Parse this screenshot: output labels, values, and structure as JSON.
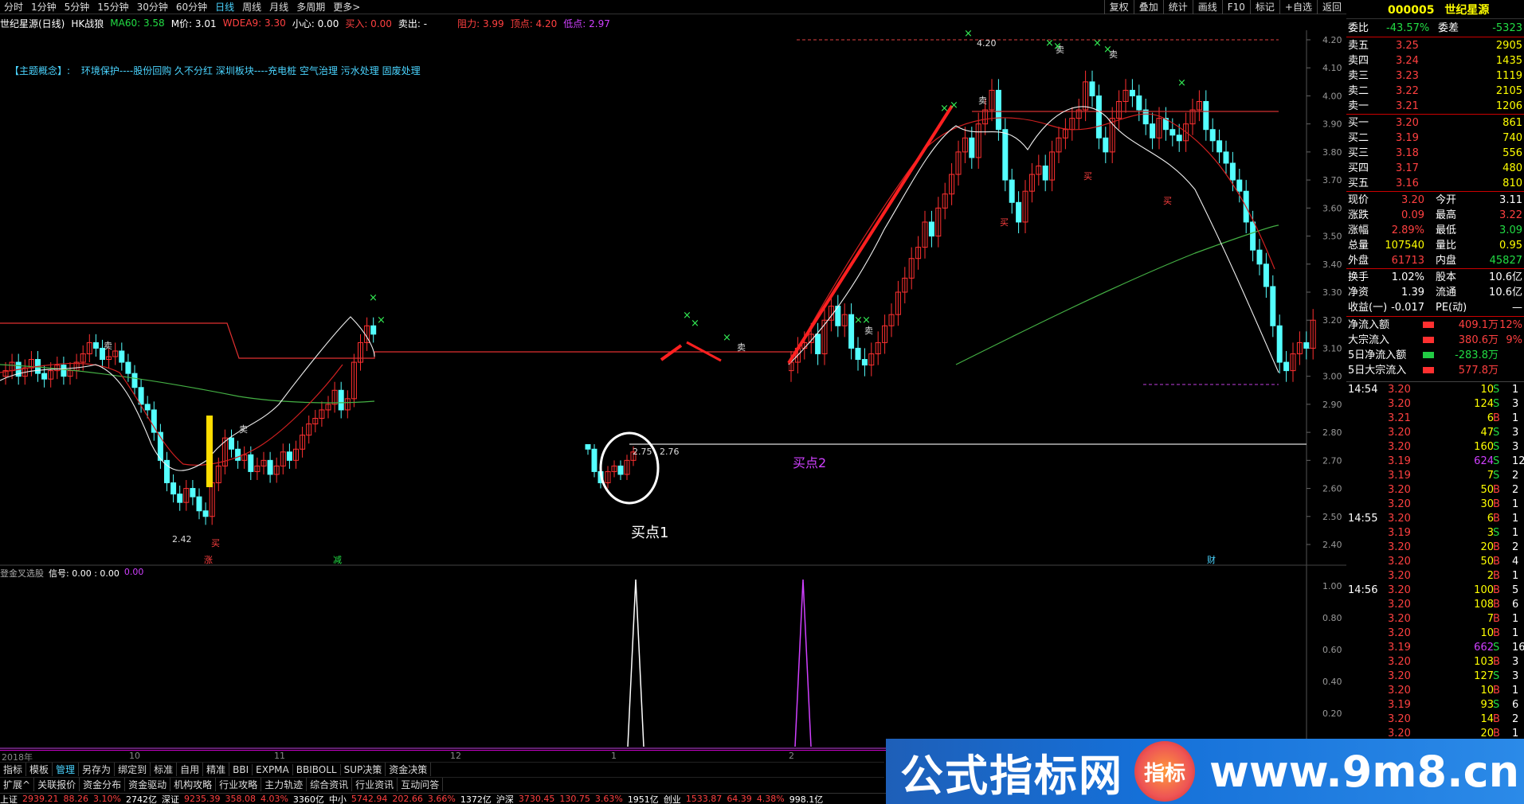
{
  "toolbar": {
    "periods": [
      "分时",
      "1分钟",
      "5分钟",
      "15分钟",
      "30分钟",
      "60分钟",
      "日线",
      "周线",
      "月线",
      "多周期",
      "更多>"
    ],
    "active": "日线",
    "right_tools": [
      "复权",
      "叠加",
      "统计",
      "画线",
      "F10",
      "标记",
      "+自选",
      "返回"
    ]
  },
  "info": {
    "name": "世纪星源(日线)",
    "plugin": "HK战狼",
    "ma60": "MA60: 3.58",
    "mprice": "M价: 3.01",
    "wdea": "WDEA9: 3.30",
    "center": "小心: 0.00",
    "buy": "买入: 0.00",
    "sell": "卖出: -",
    "resist": "阻力: 3.99",
    "top": "顶点: 4.20",
    "bottom": "低点: 2.97"
  },
  "concept": {
    "label": "【主题概念】:",
    "text": "环境保护----股份回购 久不分红 深圳板块----充电桩 空气治理 污水处理 固废处理"
  },
  "chart_labels": {
    "buy1": "买点1",
    "buy2": "买点2",
    "price_low": "2.42",
    "price_high": "4.20",
    "mid_a": "2.75",
    "mid_b": "2.76",
    "mark_zhang": "涨",
    "mark_jian": "减",
    "mark_cai": "财",
    "buy": "买",
    "sell": "卖"
  },
  "yaxis": [
    "4.20",
    "4.10",
    "4.00",
    "3.90",
    "3.80",
    "3.70",
    "3.60",
    "3.50",
    "3.40",
    "3.30",
    "3.20",
    "3.10",
    "3.00",
    "2.90",
    "2.80",
    "2.70",
    "2.60",
    "2.50",
    "2.40"
  ],
  "sub": {
    "name": "登金叉选股",
    "signal": "信号: 0.00 : 0.00",
    "val": "0.00",
    "yaxis": [
      "1.00",
      "0.80",
      "0.60",
      "0.40",
      "0.20"
    ]
  },
  "xaxis": {
    "labels": [
      "2018年",
      "10",
      "11",
      "12",
      "1",
      "2"
    ]
  },
  "ticker": {
    "code": "000005",
    "name": "世纪星源"
  },
  "quote": {
    "weibi": {
      "label": "委比",
      "value": "-43.57%",
      "label2": "委差",
      "value2": "-5323"
    },
    "sells": [
      {
        "label": "卖五",
        "price": "3.25",
        "vol": "2905"
      },
      {
        "label": "卖四",
        "price": "3.24",
        "vol": "1435"
      },
      {
        "label": "卖三",
        "price": "3.23",
        "vol": "1119"
      },
      {
        "label": "卖二",
        "price": "3.22",
        "vol": "2105"
      },
      {
        "label": "卖一",
        "price": "3.21",
        "vol": "1206"
      }
    ],
    "buys": [
      {
        "label": "买一",
        "price": "3.20",
        "vol": "861"
      },
      {
        "label": "买二",
        "price": "3.19",
        "vol": "740"
      },
      {
        "label": "买三",
        "price": "3.18",
        "vol": "556"
      },
      {
        "label": "买四",
        "price": "3.17",
        "vol": "480"
      },
      {
        "label": "买五",
        "price": "3.16",
        "vol": "810"
      }
    ],
    "stats": [
      {
        "l1": "现价",
        "v1": "3.20",
        "l2": "今开",
        "v2": "3.11",
        "c1": "red",
        "c2": "white"
      },
      {
        "l1": "涨跌",
        "v1": "0.09",
        "l2": "最高",
        "v2": "3.22",
        "c1": "red",
        "c2": "red"
      },
      {
        "l1": "涨幅",
        "v1": "2.89%",
        "l2": "最低",
        "v2": "3.09",
        "c1": "red",
        "c2": "green"
      },
      {
        "l1": "总量",
        "v1": "107540",
        "l2": "量比",
        "v2": "0.95",
        "c1": "yellow",
        "c2": "yellow"
      },
      {
        "l1": "外盘",
        "v1": "61713",
        "l2": "内盘",
        "v2": "45827",
        "c1": "red",
        "c2": "green"
      },
      {
        "l1": "换手",
        "v1": "1.02%",
        "l2": "股本",
        "v2": "10.6亿",
        "c1": "white",
        "c2": "white"
      },
      {
        "l1": "净资",
        "v1": "1.39",
        "l2": "流通",
        "v2": "10.6亿",
        "c1": "white",
        "c2": "white"
      },
      {
        "l1": "收益(一)",
        "v1": "-0.017",
        "l2": "PE(动)",
        "v2": "—",
        "c1": "white",
        "c2": "white"
      }
    ],
    "flows": [
      {
        "label": "净流入额",
        "value": "409.1万",
        "pct": "12%",
        "color": "red"
      },
      {
        "label": "大宗流入",
        "value": "380.6万",
        "pct": "9%",
        "color": "red"
      },
      {
        "label": "5日净流入额",
        "value": "-283.8万",
        "pct": "",
        "color": "green"
      },
      {
        "label": "5日大宗流入",
        "value": "577.8万",
        "pct": "",
        "color": "red"
      }
    ]
  },
  "ticks": [
    {
      "time": "14:54",
      "price": "3.20",
      "vol": "10",
      "bs": "S",
      "n": "1"
    },
    {
      "time": "",
      "price": "3.20",
      "vol": "124",
      "bs": "S",
      "n": "3"
    },
    {
      "time": "",
      "price": "3.21",
      "vol": "6",
      "bs": "B",
      "n": "1"
    },
    {
      "time": "",
      "price": "3.20",
      "vol": "47",
      "bs": "S",
      "n": "3"
    },
    {
      "time": "",
      "price": "3.20",
      "vol": "160",
      "bs": "S",
      "n": "3"
    },
    {
      "time": "",
      "price": "3.19",
      "vol": "624",
      "bs": "S",
      "n": "12"
    },
    {
      "time": "",
      "price": "3.19",
      "vol": "7",
      "bs": "S",
      "n": "2"
    },
    {
      "time": "",
      "price": "3.20",
      "vol": "50",
      "bs": "B",
      "n": "2"
    },
    {
      "time": "",
      "price": "3.20",
      "vol": "30",
      "bs": "B",
      "n": "1"
    },
    {
      "time": "14:55",
      "price": "3.20",
      "vol": "6",
      "bs": "B",
      "n": "1"
    },
    {
      "time": "",
      "price": "3.19",
      "vol": "3",
      "bs": "S",
      "n": "1"
    },
    {
      "time": "",
      "price": "3.20",
      "vol": "20",
      "bs": "B",
      "n": "2"
    },
    {
      "time": "",
      "price": "3.20",
      "vol": "50",
      "bs": "B",
      "n": "4"
    },
    {
      "time": "",
      "price": "3.20",
      "vol": "2",
      "bs": "B",
      "n": "1"
    },
    {
      "time": "14:56",
      "price": "3.20",
      "vol": "100",
      "bs": "B",
      "n": "5"
    },
    {
      "time": "",
      "price": "3.20",
      "vol": "108",
      "bs": "B",
      "n": "6"
    },
    {
      "time": "",
      "price": "3.20",
      "vol": "7",
      "bs": "B",
      "n": "1"
    },
    {
      "time": "",
      "price": "3.20",
      "vol": "10",
      "bs": "B",
      "n": "1"
    },
    {
      "time": "",
      "price": "3.19",
      "vol": "662",
      "bs": "S",
      "n": "16"
    },
    {
      "time": "",
      "price": "3.20",
      "vol": "103",
      "bs": "B",
      "n": "3"
    },
    {
      "time": "",
      "price": "3.20",
      "vol": "127",
      "bs": "S",
      "n": "3"
    },
    {
      "time": "",
      "price": "3.20",
      "vol": "10",
      "bs": "B",
      "n": "1"
    },
    {
      "time": "",
      "price": "3.19",
      "vol": "93",
      "bs": "S",
      "n": "6"
    },
    {
      "time": "",
      "price": "3.20",
      "vol": "14",
      "bs": "B",
      "n": "2"
    },
    {
      "time": "",
      "price": "3.20",
      "vol": "20",
      "bs": "B",
      "n": "1"
    }
  ],
  "bottom_tabs1": [
    "指标",
    "模板",
    "管理",
    "另存为",
    "绑定到",
    "标准",
    "自用",
    "精准",
    "BBI",
    "EXPMA",
    "BBIBOLL",
    "SUP决策",
    "资金决策"
  ],
  "bottom_tabs1_active": "管理",
  "bottom_tabs2": [
    "扩展^",
    "关联报价",
    "资金分布",
    "资金驱动",
    "机构攻略",
    "行业攻略",
    "主力轨迹",
    "综合资讯",
    "行业资讯",
    "互动问答"
  ],
  "status": [
    {
      "t": "上证",
      "c": "white"
    },
    {
      "t": "2939.21",
      "c": "red"
    },
    {
      "t": "88.26",
      "c": "red"
    },
    {
      "t": "3.10%",
      "c": "red"
    },
    {
      "t": "2742亿",
      "c": "white"
    },
    {
      "t": "深证",
      "c": "white"
    },
    {
      "t": "9235.39",
      "c": "red"
    },
    {
      "t": "358.08",
      "c": "red"
    },
    {
      "t": "4.03%",
      "c": "red"
    },
    {
      "t": "3360亿",
      "c": "white"
    },
    {
      "t": "中小",
      "c": "white"
    },
    {
      "t": "5742.94",
      "c": "red"
    },
    {
      "t": "202.66",
      "c": "red"
    },
    {
      "t": "3.66%",
      "c": "red"
    },
    {
      "t": "1372亿",
      "c": "white"
    },
    {
      "t": "沪深",
      "c": "white"
    },
    {
      "t": "3730.45",
      "c": "red"
    },
    {
      "t": "130.75",
      "c": "red"
    },
    {
      "t": "3.63%",
      "c": "red"
    },
    {
      "t": "1951亿",
      "c": "white"
    },
    {
      "t": "创业",
      "c": "white"
    },
    {
      "t": "1533.87",
      "c": "red"
    },
    {
      "t": "64.39",
      "c": "red"
    },
    {
      "t": "4.38%",
      "c": "red"
    },
    {
      "t": "998.1亿",
      "c": "white"
    }
  ],
  "brand": {
    "text1": "公式指标网",
    "logo": "指标",
    "text2": "www.9m8.cn"
  },
  "colors": {
    "up": "#ff3030",
    "down": "#54ffff",
    "ma": "#ffffff",
    "accent": "#4ad4ff",
    "magenta": "#d040ff",
    "yellow": "#ffff00"
  }
}
